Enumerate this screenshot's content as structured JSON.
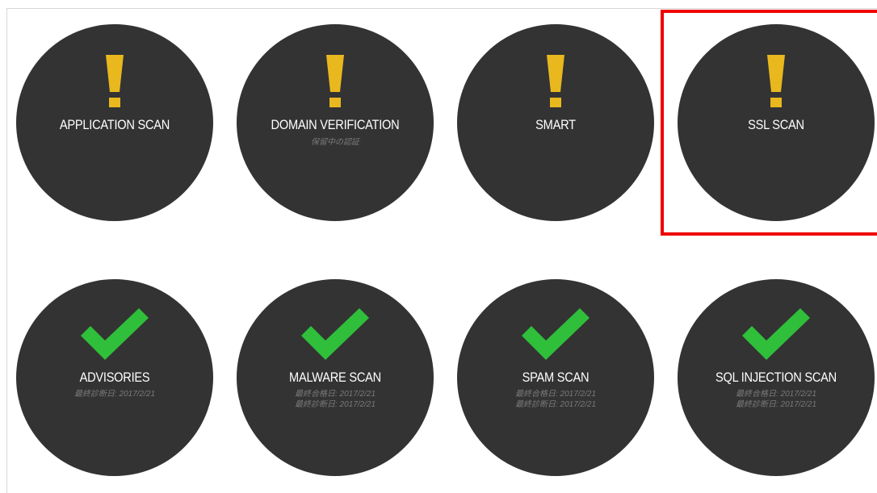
{
  "colors": {
    "circle": "#333333",
    "warning": "#e8b81e",
    "check": "#2fbf3a",
    "highlight": "#ee0000",
    "subtext": "#7a7a7a"
  },
  "tiles_top": [
    {
      "label": "APPLICATION SCAN",
      "icon": "warning-exclamation-icon",
      "sub": []
    },
    {
      "label": "DOMAIN VERIFICATION",
      "icon": "warning-exclamation-icon",
      "sub": [
        "保留中の認証"
      ]
    },
    {
      "label": "SMART",
      "icon": "warning-exclamation-icon",
      "sub": []
    },
    {
      "label": "SSL SCAN",
      "icon": "warning-exclamation-icon",
      "sub": []
    }
  ],
  "tiles_bottom": [
    {
      "label": "ADVISORIES",
      "icon": "checkmark-icon",
      "sub": [
        "最終診断日: 2017/2/21"
      ]
    },
    {
      "label": "MALWARE SCAN",
      "icon": "checkmark-icon",
      "sub": [
        "最終合格日: 2017/2/21",
        "最終診断日: 2017/2/21"
      ]
    },
    {
      "label": "SPAM SCAN",
      "icon": "checkmark-icon",
      "sub": [
        "最終合格日: 2017/2/21",
        "最終診断日: 2017/2/21"
      ]
    },
    {
      "label": "SQL INJECTION SCAN",
      "icon": "checkmark-icon",
      "sub": [
        "最終合格日: 2017/2/21",
        "最終診断日: 2017/2/21"
      ]
    }
  ]
}
